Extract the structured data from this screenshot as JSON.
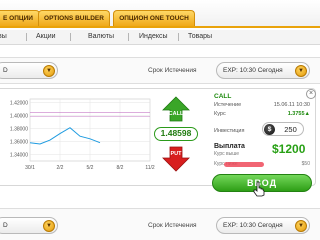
{
  "tabs": [
    {
      "label": "Е ОПЦИИ"
    },
    {
      "label": "OPTIONS BUILDER"
    },
    {
      "label": "ОПЦИОН ONE TOUCH"
    }
  ],
  "categories": [
    "вы",
    "Акции",
    "Валюты",
    "Индексы",
    "Товары"
  ],
  "row1": {
    "asset_value": "D",
    "expiry_label": "Срок Истечения",
    "expiry_value": "EXP: 10:30 Сегодня"
  },
  "chart": {
    "y_ticks": [
      "1.42000",
      "1.40000",
      "1.38000",
      "1.36000",
      "1.34000"
    ],
    "x_ticks": [
      "30/1",
      "2/2",
      "5/2",
      "8/2",
      "11/2"
    ]
  },
  "chart_data": {
    "type": "line",
    "x": [
      "30/1",
      "31/1",
      "1/2",
      "2/2",
      "3/2",
      "4/2",
      "5/2",
      "6/2",
      "7/2",
      "8/2",
      "9/2",
      "10/2",
      "11/2"
    ],
    "series": [
      {
        "values": [
          1.358,
          1.356,
          1.362,
          1.372,
          1.381,
          1.368,
          1.364,
          1.358,
          null,
          null,
          null,
          null,
          null
        ]
      }
    ],
    "ylim": [
      1.33,
      1.425
    ],
    "reference_lines": [
      1.404,
      1.398
    ],
    "title": "",
    "xlabel": "",
    "ylabel": ""
  },
  "trade": {
    "call_label": "CALL",
    "put_label": "PUT",
    "price": "1.48598"
  },
  "card": {
    "type": "CALL",
    "expiry_label": "Истечение",
    "expiry_value": "15.06.11 10:30",
    "rate_label": "Курс",
    "rate_value": "1.3755▲",
    "invest_label": "Инвестиция",
    "invest_currency": "$",
    "invest_value": "250",
    "payout_label": "Выплата",
    "payout_sub": "Курс выше",
    "payout_value": "$1200",
    "rate2_label": "Курс ниже",
    "rate2_value": "$50",
    "enter_label": "ВВОД",
    "close_icon": "×"
  },
  "row2": {
    "asset_value": "D",
    "expiry_label": "Срок Истечения",
    "expiry_value": "EXP: 10:30 Сегодня"
  },
  "colors": {
    "accent": "#f0a91a",
    "call_green": "#28a015",
    "put_red": "#d81e1e"
  }
}
